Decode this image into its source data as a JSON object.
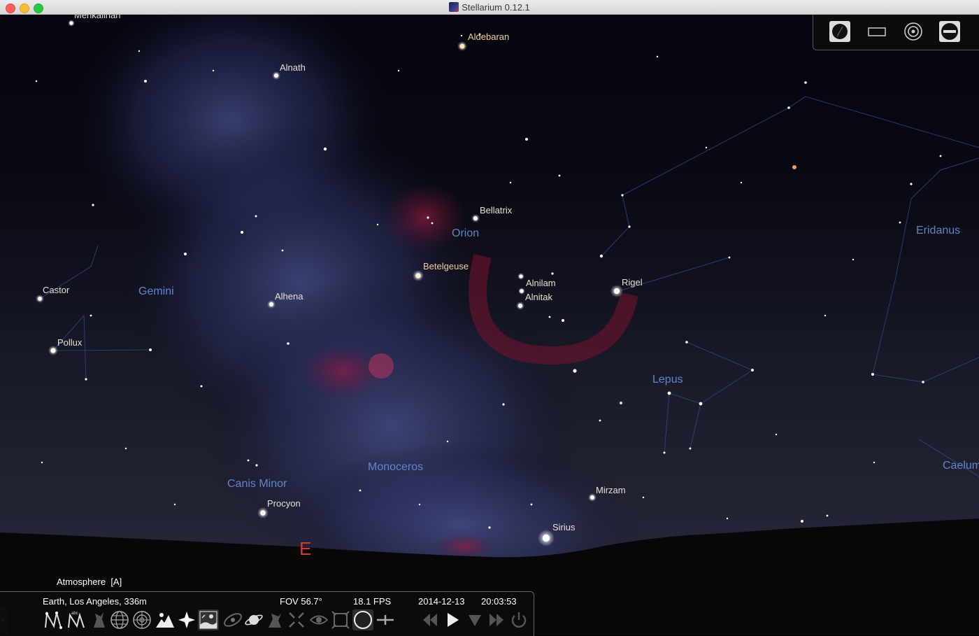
{
  "window": {
    "title": "Stellarium 0.12.1"
  },
  "sky": {
    "star_labels": [
      {
        "id": "aldebaran",
        "text": "Aldebaran",
        "warm": true
      },
      {
        "id": "alnath",
        "text": "Alnath",
        "warm": false
      },
      {
        "id": "menkalinan",
        "text": "Menkalinan",
        "warm": false
      },
      {
        "id": "bellatrix",
        "text": "Bellatrix",
        "warm": false
      },
      {
        "id": "betelgeuse",
        "text": "Betelgeuse",
        "warm": true
      },
      {
        "id": "alnilam",
        "text": "Alnilam",
        "warm": false
      },
      {
        "id": "alnitak",
        "text": "Alnitak",
        "warm": false
      },
      {
        "id": "rigel",
        "text": "Rigel",
        "warm": false
      },
      {
        "id": "castor",
        "text": "Castor",
        "warm": false
      },
      {
        "id": "pollux",
        "text": "Pollux",
        "warm": false
      },
      {
        "id": "alhena",
        "text": "Alhena",
        "warm": false
      },
      {
        "id": "procyon",
        "text": "Procyon",
        "warm": false
      },
      {
        "id": "mirzam",
        "text": "Mirzam",
        "warm": false
      },
      {
        "id": "sirius",
        "text": "Sirius",
        "warm": false
      }
    ],
    "constellation_labels": [
      {
        "id": "orion",
        "text": "Orion"
      },
      {
        "id": "gemini",
        "text": "Gemini"
      },
      {
        "id": "eridanus",
        "text": "Eridanus"
      },
      {
        "id": "lepus",
        "text": "Lepus"
      },
      {
        "id": "monoceros",
        "text": "Monoceros"
      },
      {
        "id": "canis-minor",
        "text": "Canis Minor"
      },
      {
        "id": "caelum",
        "text": "Caelum"
      }
    ],
    "cardinal": "E",
    "colors": {
      "constellation_label": "#5f86c8",
      "star_label": "#e6e0d4",
      "cardinal": "#d23a2a"
    }
  },
  "topright_icons": [
    "night-mode-icon",
    "fullscreen-icon",
    "astronomical-calculations-icon",
    "help-window-icon"
  ],
  "status": {
    "hover_tooltip": "Atmosphere  [A]",
    "location": "Earth, Los Angeles, 336m",
    "fov": "FOV 56.7°",
    "fps": "18.1 FPS",
    "date": "2014-12-13",
    "time": "20:03:53"
  },
  "toolbar_icons": [
    "constellation-lines-icon",
    "constellation-labels-icon",
    "constellation-art-icon",
    "equatorial-grid-icon",
    "azimuthal-grid-icon",
    "ground-icon",
    "cardinal-points-icon",
    "atmosphere-icon",
    "nebulae-icon",
    "planet-labels-icon",
    "mount-icon",
    "center-selected-icon",
    "night-vision-icon",
    "fullscreen-toggle-icon",
    "ocular-icon",
    "telrad-icon",
    "rewind-icon",
    "play-icon",
    "real-time-icon",
    "fast-forward-icon",
    "quit-icon"
  ]
}
